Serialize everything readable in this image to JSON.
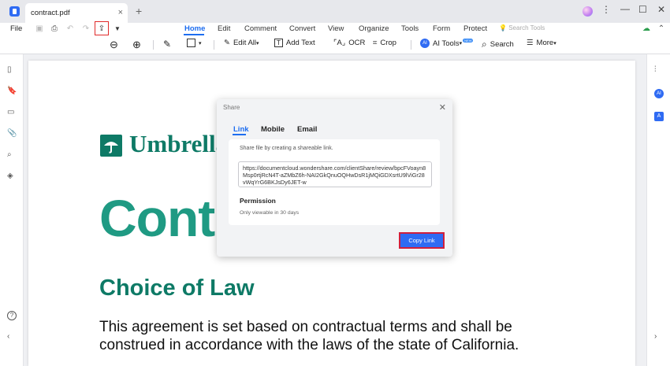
{
  "titlebar": {
    "tab_title": "contract.pdf",
    "tab_close": "×",
    "new_tab": "+",
    "minimize": "—",
    "maximize": "☐",
    "close": "✕"
  },
  "menu": {
    "file": "File",
    "tabs": [
      "Home",
      "Edit",
      "Comment",
      "Convert",
      "View",
      "Organize",
      "Tools",
      "Form",
      "Protect"
    ],
    "active_tab": "Home",
    "search_tools_placeholder": "Search Tools"
  },
  "toolbar": {
    "edit_all": "Edit All",
    "add_text": "Add Text",
    "ocr": "OCR",
    "crop": "Crop",
    "ai_tools": "AI Tools",
    "search": "Search",
    "more": "More"
  },
  "document": {
    "logo_text": "Umbrella",
    "title": "Contra",
    "heading": "Choice of Law",
    "body": "This agreement is set based on contractual terms and shall be construed in accordance with the laws of the state of California."
  },
  "share_dialog": {
    "title": "Share",
    "close": "✕",
    "tabs": [
      "Link",
      "Mobile",
      "Email"
    ],
    "active_tab": "Link",
    "description": "Share file by creating a shareable link.",
    "link": "https://documentcloud.wondershare.com/clientShare/review/bpcFVoayn8Msp0rtjRcN4T-aZMbZ6h-NAI2GkQnuOQHwDsR1jMQiGDXsrtU9lViGr28vWqYrG6BKJsDy6JET-w",
    "permission_title": "Permission",
    "permission_note": "Only viewable in 30 days",
    "copy_button": "Copy Link"
  },
  "colors": {
    "accent": "#2f6bf3",
    "brand_green": "#0e7a66",
    "highlight": "#e02b2b"
  }
}
